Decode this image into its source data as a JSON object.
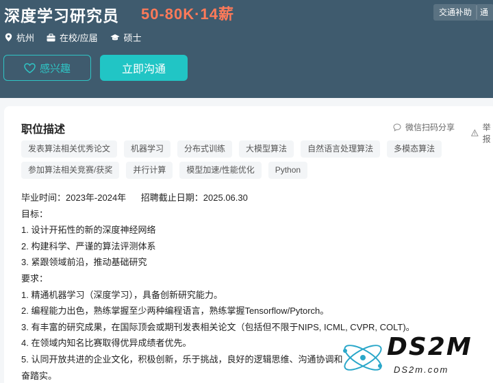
{
  "job": {
    "title": "深度学习研究员",
    "salary": "50-80K·14薪",
    "benefits": [
      "交通补助",
      "通"
    ],
    "city": "杭州",
    "experience": "在校/应届",
    "degree": "硕士"
  },
  "actions": {
    "interest_label": "感兴趣",
    "chat_label": "立即沟通"
  },
  "card": {
    "section_title": "职位描述",
    "share_label": "微信扫码分享",
    "report_label": "举报"
  },
  "tags": [
    [
      "发表算法相关优秀论文",
      "机器学习",
      "分布式训练",
      "大模型算法",
      "自然语言处理算法",
      "多模态算法"
    ],
    [
      "参加算法相关竞赛/获奖",
      "并行计算",
      "模型加速/性能优化",
      "Python"
    ]
  ],
  "description": {
    "graduation": "毕业时间：2023年-2024年",
    "deadline": "招聘截止日期：2025.06.30",
    "goal_heading": "目标：",
    "goals": [
      "1. 设计开拓性的新的深度神经网络",
      "2. 构建科学、严谨的算法评测体系",
      "3. 紧跟领域前沿，推动基础研究"
    ],
    "req_heading": "要求：",
    "requirements": [
      "1. 精通机器学习（深度学习），具备创新研究能力。",
      "2. 编程能力出色，熟练掌握至少两种编程语言，熟练掌握Tensorflow/Pytorch。",
      "3. 有丰富的研究成果，在国际顶会或期刊发表相关论文（包括但不限于NIPS, ICML, CVPR, COLT)。",
      "4. 在领域内知名比赛取得优异成绩者优先。",
      "5. 认同开放共进的企业文化，积极创新，乐于挑战，良好的逻辑思维、沟通协调和",
      "奋踏实。"
    ]
  },
  "watermark": {
    "logo": "DS2M",
    "url": "DS2m.com"
  },
  "colors": {
    "header_bg": "#3f5b6e",
    "accent": "#21c5c5",
    "salary": "#ff7a59"
  }
}
